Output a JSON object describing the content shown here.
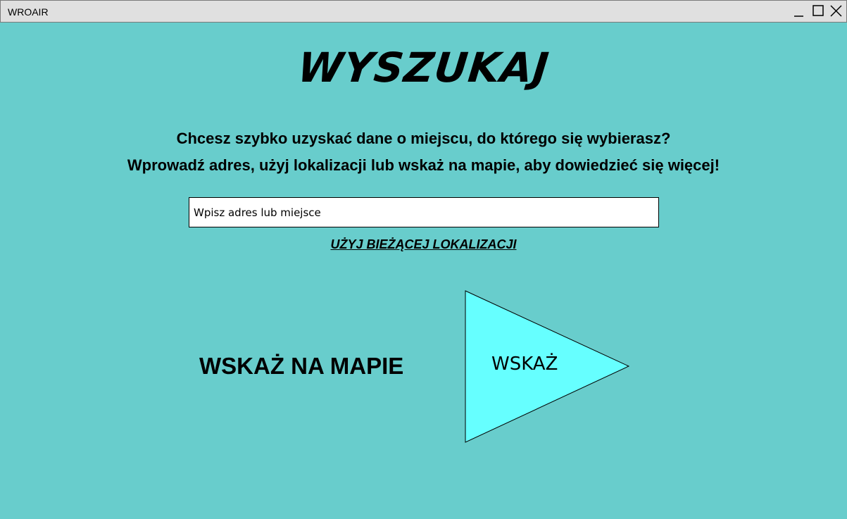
{
  "window": {
    "title": "WROAIR",
    "controls": [
      "minimize-icon",
      "maximize-icon",
      "close-icon"
    ]
  },
  "main": {
    "heading": "WYSZUKAJ",
    "intro_line1": "Chcesz szybko uzyskać dane o miejscu, do którego się wybierasz?",
    "intro_line2": "Wprowadź adres, użyj lokalizacji lub wskaż na mapie, aby dowiedzieć się więcej!",
    "search": {
      "value": "",
      "placeholder": "Wpisz adres lub miejsce"
    },
    "location_link": "UŻYJ BIEŻĄCEJ LOKALIZACJI",
    "map_label": "WSKAŻ NA MAPIE",
    "point_button_label": "WSKAŻ"
  },
  "colors": {
    "background": "#68CDCC",
    "titlebar": "#E0E0E0",
    "triangle_fill": "#66FFFF"
  }
}
